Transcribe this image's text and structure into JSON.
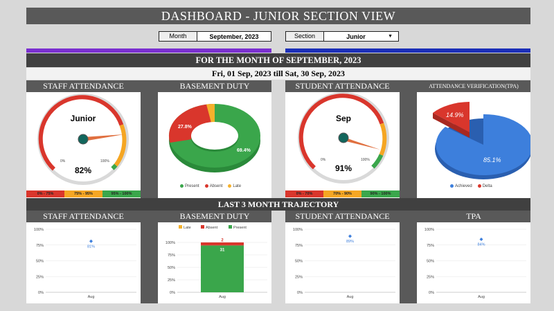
{
  "header": {
    "title": "DASHBOARD - JUNIOR SECTION VIEW"
  },
  "filters": {
    "month_label": "Month",
    "month_value": "September, 2023",
    "section_label": "Section",
    "section_value": "Junior"
  },
  "month_band": "FOR THE MONTH OF SEPTEMBER, 2023",
  "date_range": "Fri, 01 Sep, 2023 till Sat, 30 Sep, 2023",
  "trajectory_band": "LAST 3 MONTH TRAJECTORY",
  "staff_attendance": {
    "title": "STAFF ATTENDANCE",
    "gauge_label": "Junior",
    "value": "82%",
    "value_num": 82,
    "min": "0%",
    "max": "100%",
    "ranges": [
      "0% - 75%",
      "75% - 95%",
      "95% - 100%"
    ]
  },
  "basement_duty": {
    "title": "BASEMENT DUTY",
    "slices": [
      {
        "name": "Present",
        "value": 69.4,
        "label": "69.4%",
        "color": "#3aa64b"
      },
      {
        "name": "Absent",
        "value": 27.8,
        "label": "27.8%",
        "color": "#d9362c"
      },
      {
        "name": "Late",
        "value": 2.8,
        "label": "",
        "color": "#f5b12c"
      }
    ]
  },
  "student_attendance": {
    "title": "STUDENT ATTENDANCE",
    "gauge_label": "Sep",
    "value": "91%",
    "value_num": 91,
    "min": "0%",
    "max": "100%",
    "ranges": [
      "0% - 70%",
      "70% - 90%",
      "90% - 100%"
    ]
  },
  "tpa": {
    "title": "ATTENDANCE VERIFICATION(TPA)",
    "slices": [
      {
        "name": "Achieved",
        "value": 85.1,
        "label": "85.1%",
        "color": "#3d7fdc"
      },
      {
        "name": "Delta",
        "value": 14.9,
        "label": "14.9%",
        "color": "#d9362c"
      }
    ]
  },
  "traj_titles": [
    "STAFF ATTENDANCE",
    "BASEMENT DUTY",
    "STUDENT ATTENDANCE",
    "TPA"
  ],
  "y_ticks": [
    "100%",
    "75%",
    "50%",
    "25%",
    "0%"
  ],
  "x_label": "Aug",
  "chart_data": [
    {
      "type": "scatter",
      "title": "STAFF ATTENDANCE",
      "categories": [
        "Aug"
      ],
      "values": [
        81
      ],
      "labels": [
        "81%"
      ],
      "ylim": [
        0,
        100
      ]
    },
    {
      "type": "bar",
      "title": "BASEMENT DUTY",
      "categories": [
        "Aug"
      ],
      "series": [
        {
          "name": "Late",
          "values": [
            0
          ]
        },
        {
          "name": "Absent",
          "values": [
            2
          ]
        },
        {
          "name": "Present",
          "values": [
            31
          ]
        }
      ],
      "labels": {
        "Absent": "2",
        "Present": "31"
      },
      "ylim": [
        0,
        100
      ]
    },
    {
      "type": "scatter",
      "title": "STUDENT ATTENDANCE",
      "categories": [
        "Aug"
      ],
      "values": [
        89
      ],
      "labels": [
        "89%"
      ],
      "ylim": [
        0,
        100
      ]
    },
    {
      "type": "scatter",
      "title": "TPA",
      "categories": [
        "Aug"
      ],
      "values": [
        84
      ],
      "labels": [
        "84%"
      ],
      "ylim": [
        0,
        100
      ]
    }
  ]
}
